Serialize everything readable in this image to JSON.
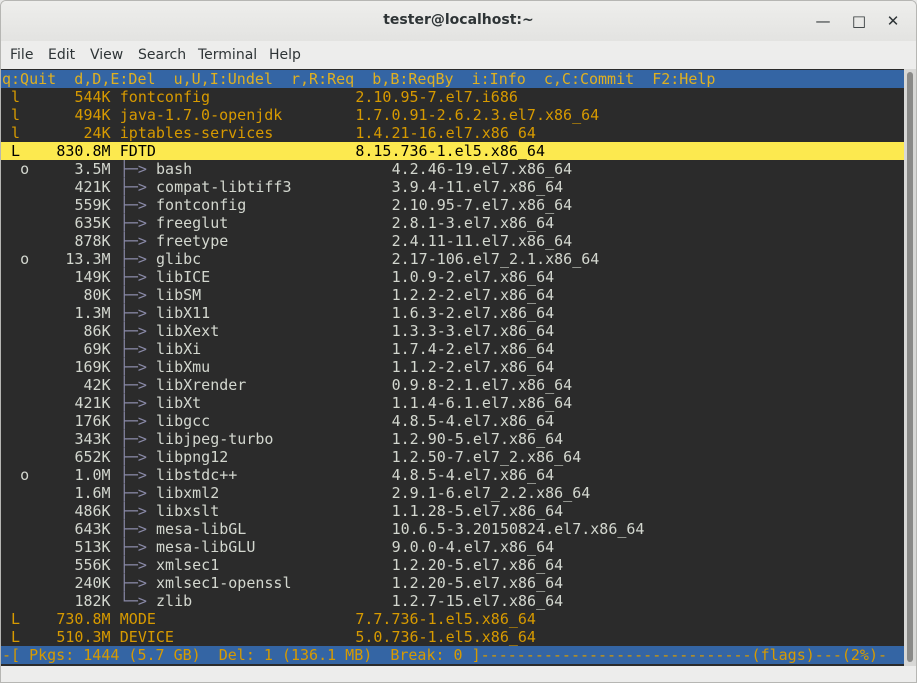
{
  "window": {
    "title": "tester@localhost:~",
    "minimize_icon": "minimize-icon",
    "maximize_icon": "maximize-icon",
    "close_icon": "close-icon"
  },
  "menu": [
    "File",
    "Edit",
    "View",
    "Search",
    "Terminal",
    "Help"
  ],
  "keybar": "q:Quit  d,D,E:Del  u,U,I:Undel  r,R:Req  b,B:ReqBy  i:Info  c,C:Commit  F2:Help",
  "top_packages": [
    {
      "flag": "l",
      "size": "544K",
      "name": "fontconfig",
      "version": "2.10.95-7.el7.i686"
    },
    {
      "flag": "l",
      "size": "494K",
      "name": "java-1.7.0-openjdk",
      "version": "1.7.0.91-2.6.2.3.el7.x86_64"
    },
    {
      "flag": "l",
      "size": "24K",
      "name": "iptables-services",
      "version": "1.4.21-16.el7.x86_64"
    }
  ],
  "selected": {
    "flag": "L",
    "size": "830.8M",
    "name": "FDTD",
    "version": "8.15.736-1.el5.x86_64"
  },
  "deps": [
    {
      "flag": "o",
      "size": "3.5M",
      "name": "bash",
      "version": "4.2.46-19.el7.x86_64"
    },
    {
      "flag": "",
      "size": "421K",
      "name": "compat-libtiff3",
      "version": "3.9.4-11.el7.x86_64"
    },
    {
      "flag": "",
      "size": "559K",
      "name": "fontconfig",
      "version": "2.10.95-7.el7.x86_64"
    },
    {
      "flag": "",
      "size": "635K",
      "name": "freeglut",
      "version": "2.8.1-3.el7.x86_64"
    },
    {
      "flag": "",
      "size": "878K",
      "name": "freetype",
      "version": "2.4.11-11.el7.x86_64"
    },
    {
      "flag": "o",
      "size": "13.3M",
      "name": "glibc",
      "version": "2.17-106.el7_2.1.x86_64"
    },
    {
      "flag": "",
      "size": "149K",
      "name": "libICE",
      "version": "1.0.9-2.el7.x86_64"
    },
    {
      "flag": "",
      "size": "80K",
      "name": "libSM",
      "version": "1.2.2-2.el7.x86_64"
    },
    {
      "flag": "",
      "size": "1.3M",
      "name": "libX11",
      "version": "1.6.3-2.el7.x86_64"
    },
    {
      "flag": "",
      "size": "86K",
      "name": "libXext",
      "version": "1.3.3-3.el7.x86_64"
    },
    {
      "flag": "",
      "size": "69K",
      "name": "libXi",
      "version": "1.7.4-2.el7.x86_64"
    },
    {
      "flag": "",
      "size": "169K",
      "name": "libXmu",
      "version": "1.1.2-2.el7.x86_64"
    },
    {
      "flag": "",
      "size": "42K",
      "name": "libXrender",
      "version": "0.9.8-2.1.el7.x86_64"
    },
    {
      "flag": "",
      "size": "421K",
      "name": "libXt",
      "version": "1.1.4-6.1.el7.x86_64"
    },
    {
      "flag": "",
      "size": "176K",
      "name": "libgcc",
      "version": "4.8.5-4.el7.x86_64"
    },
    {
      "flag": "",
      "size": "343K",
      "name": "libjpeg-turbo",
      "version": "1.2.90-5.el7.x86_64"
    },
    {
      "flag": "",
      "size": "652K",
      "name": "libpng12",
      "version": "1.2.50-7.el7_2.x86_64"
    },
    {
      "flag": "o",
      "size": "1.0M",
      "name": "libstdc++",
      "version": "4.8.5-4.el7.x86_64"
    },
    {
      "flag": "",
      "size": "1.6M",
      "name": "libxml2",
      "version": "2.9.1-6.el7_2.2.x86_64"
    },
    {
      "flag": "",
      "size": "486K",
      "name": "libxslt",
      "version": "1.1.28-5.el7.x86_64"
    },
    {
      "flag": "",
      "size": "643K",
      "name": "mesa-libGL",
      "version": "10.6.5-3.20150824.el7.x86_64"
    },
    {
      "flag": "",
      "size": "513K",
      "name": "mesa-libGLU",
      "version": "9.0.0-4.el7.x86_64"
    },
    {
      "flag": "",
      "size": "556K",
      "name": "xmlsec1",
      "version": "1.2.20-5.el7.x86_64"
    },
    {
      "flag": "",
      "size": "240K",
      "name": "xmlsec1-openssl",
      "version": "1.2.20-5.el7.x86_64"
    },
    {
      "flag": "",
      "size": "182K",
      "name": "zlib",
      "version": "1.2.7-15.el7.x86_64"
    }
  ],
  "tree_arrow": "├─> ",
  "tree_arrow_last": "└─> ",
  "bottom_packages": [
    {
      "flag": "L",
      "size": "730.8M",
      "name": "MODE",
      "version": "7.7.736-1.el5.x86_64"
    },
    {
      "flag": "L",
      "size": "510.3M",
      "name": "DEVICE",
      "version": "5.0.736-1.el5.x86_64"
    }
  ],
  "statusbar": "-[ Pkgs: 1444 (5.7 GB)  Del: 1 (136.1 MB)  Break: 0 ]------------------------------(flags)---(2%)-"
}
